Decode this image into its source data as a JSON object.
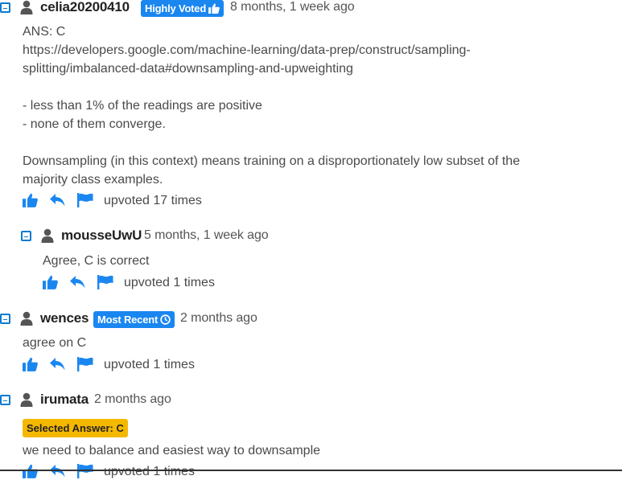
{
  "comments": [
    {
      "username": "celia20200410",
      "badge": "Highly Voted",
      "time": "8 months, 1 week ago",
      "lines": [
        "ANS: C",
        "https://developers.google.com/machine-learning/data-prep/construct/sampling-",
        "splitting/imbalanced-data#downsampling-and-upweighting",
        "",
        "- less than 1% of the readings are positive",
        "- none of them converge.",
        "",
        "Downsampling (in this context) means training on a disproportionately low subset of the",
        "majority class examples."
      ],
      "upvotes": "upvoted 17 times"
    },
    {
      "username": "mousseUwU",
      "time": "5 months, 1 week ago",
      "text": "Agree, C is correct",
      "upvotes": "upvoted 1 times"
    },
    {
      "username": "wences",
      "badge": "Most Recent",
      "time": "2 months ago",
      "text": "agree on C",
      "upvotes": "upvoted 1 times"
    },
    {
      "username": "irumata",
      "time": "2 months ago",
      "selected_answer": "Selected Answer: C",
      "text": "we need to balance and easiest way to downsample",
      "upvotes": "upvoted 1 times"
    }
  ],
  "icons": {
    "toggle": "collapse-minus-icon",
    "user": "user-icon",
    "upvote": "thumbs-up-icon",
    "reply": "reply-icon",
    "flag": "flag-icon",
    "clock": "clock-icon"
  },
  "colors": {
    "accent": "#1a86f0",
    "selected_badge": "#f5b800",
    "action_icons": "#1a86f0"
  }
}
